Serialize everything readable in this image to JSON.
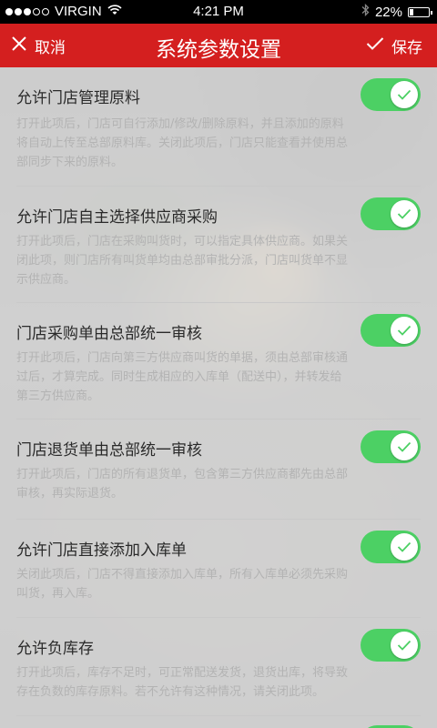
{
  "status_bar": {
    "carrier": "VIRGIN",
    "time": "4:21 PM",
    "battery_text": "22%",
    "battery_level": 0.22
  },
  "nav": {
    "cancel_label": "取消",
    "title": "系统参数设置",
    "save_label": "保存"
  },
  "colors": {
    "nav_red": "#d41f1f",
    "toggle_on": "#4cd064"
  },
  "settings": [
    {
      "title": "允许门店管理原料",
      "desc_lines": [
        "打开此项后，门店可自行添加/修改/删除原料，并且添加的原料",
        "将自动上传至总部原料库。关闭此项后，门店只能查看并使用总",
        "部同步下来的原料。"
      ],
      "enabled": true
    },
    {
      "title": "允许门店自主选择供应商采购",
      "desc_lines": [
        "打开此项后，门店在采购叫货时，可以指定具体供应商。如果关",
        "闭此项，则门店所有叫货单均由总部审批分派，门店叫货单不显",
        "示供应商。"
      ],
      "enabled": true
    },
    {
      "title": "门店采购单由总部统一审核",
      "desc_lines": [
        "打开此项后，门店向第三方供应商叫货的单据，须由总部审核通",
        "过后，才算完成。同时生成相应的入库单（配送中），并转发给",
        "第三方供应商。"
      ],
      "enabled": true
    },
    {
      "title": "门店退货单由总部统一审核",
      "desc_lines": [
        "打开此项后，门店的所有退货单，包含第三方供应商都先由总部",
        "审核，再实际退货。"
      ],
      "enabled": true
    },
    {
      "title": "允许门店直接添加入库单",
      "desc_lines": [
        "关闭此项后，门店不得直接添加入库单，所有入库单必须先采购",
        "叫货，再入库。"
      ],
      "enabled": true
    },
    {
      "title": "允许负库存",
      "desc_lines": [
        "打开此项后，库存不足时，可正常配送发货，退货出库，将导致",
        "存在负数的库存原料。若不允许有这种情况，请关闭此项。"
      ],
      "enabled": true
    }
  ]
}
